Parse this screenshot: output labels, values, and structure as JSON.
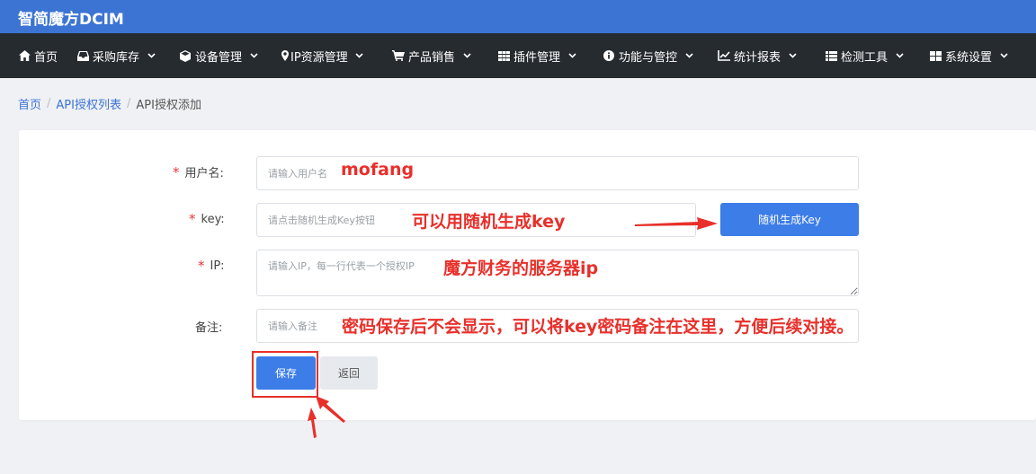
{
  "app": {
    "title": "智简魔方DCIM"
  },
  "nav": {
    "items": [
      {
        "label": "首页",
        "icon": "home-icon"
      },
      {
        "label": "采购库存",
        "icon": "inbox-icon"
      },
      {
        "label": "设备管理",
        "icon": "cube-icon"
      },
      {
        "label": "IP资源管理",
        "icon": "map-marker-icon"
      },
      {
        "label": "产品销售",
        "icon": "cart-icon"
      },
      {
        "label": "插件管理",
        "icon": "grid-icon"
      },
      {
        "label": "功能与管控",
        "icon": "info-icon"
      },
      {
        "label": "统计报表",
        "icon": "line-chart-icon"
      },
      {
        "label": "检测工具",
        "icon": "list-icon"
      },
      {
        "label": "系统设置",
        "icon": "th-icon"
      }
    ]
  },
  "breadcrumb": {
    "home": "首页",
    "list": "API授权列表",
    "current": "API授权添加",
    "separator": "/"
  },
  "form": {
    "username": {
      "label": "用户名:",
      "placeholder": "请输入用户名",
      "value": ""
    },
    "key": {
      "label": "key:",
      "placeholder": "请点击随机生成Key按钮",
      "value": ""
    },
    "generate_key_label": "随机生成Key",
    "ip": {
      "label": "IP:",
      "placeholder": "请输入IP，每一行代表一个授权IP",
      "value": ""
    },
    "remark": {
      "label": "备注:",
      "placeholder": "请输入备注",
      "value": ""
    },
    "required_mark": "*",
    "save_label": "保存",
    "back_label": "返回"
  },
  "annotations": {
    "username": "mofang",
    "key": "可以用随机生成key",
    "ip": "魔方财务的服务器ip",
    "remark": "密码保存后不会显示，可以将key密码备注在这里，方便后续对接。"
  },
  "colors": {
    "header": "#3c74d4",
    "navbar": "#262b30",
    "primary": "#3c7de8",
    "annotation": "#e8302b"
  }
}
